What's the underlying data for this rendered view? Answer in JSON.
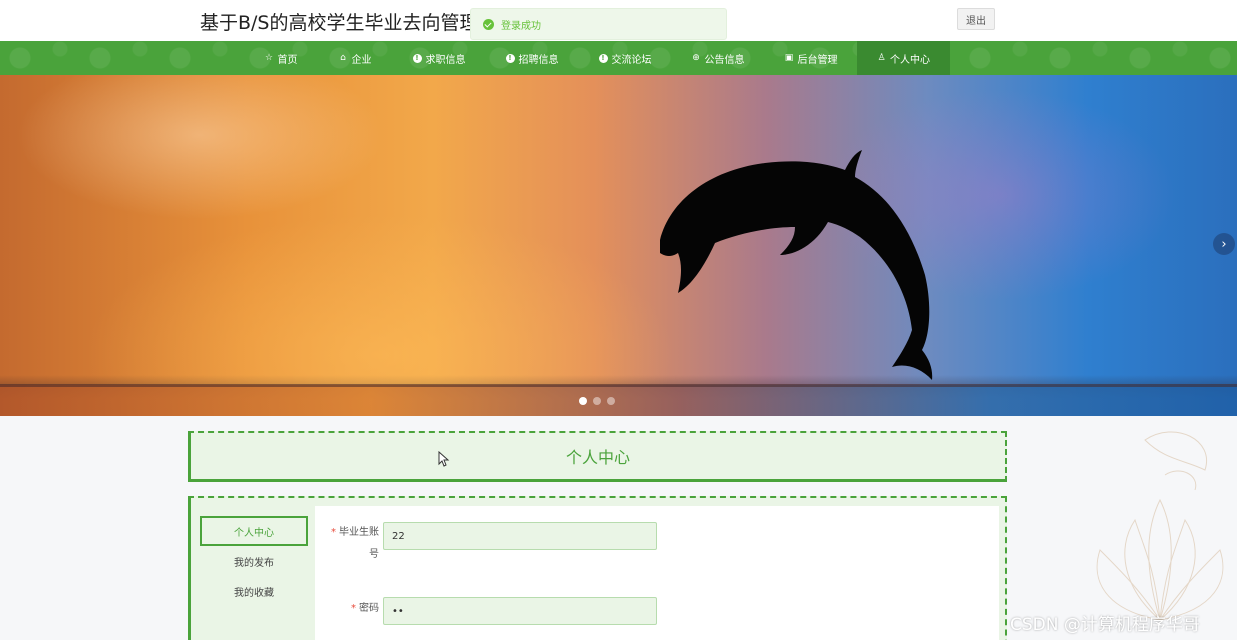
{
  "header": {
    "site_title": "基于B/S的高校学生毕业去向管理系统",
    "toast_message": "登录成功",
    "logout_label": "退出"
  },
  "nav": {
    "items": [
      {
        "label": "首页",
        "icon": "star-icon"
      },
      {
        "label": "企业",
        "icon": "home-icon"
      },
      {
        "label": "求职信息",
        "icon": "info-icon"
      },
      {
        "label": "招聘信息",
        "icon": "info-icon"
      },
      {
        "label": "交流论坛",
        "icon": "info-icon"
      },
      {
        "label": "公告信息",
        "icon": "globe-icon"
      },
      {
        "label": "后台管理",
        "icon": "briefcase-icon"
      },
      {
        "label": "个人中心",
        "icon": "user-icon"
      }
    ],
    "active": "个人中心",
    "color": "#4aa33b"
  },
  "banner": {
    "slide_count": 3,
    "active_slide": 1,
    "next_icon": "›"
  },
  "page": {
    "title": "个人中心"
  },
  "side_menu": {
    "items": [
      "个人中心",
      "我的发布",
      "我的收藏"
    ],
    "active": "个人中心"
  },
  "form": {
    "fields": [
      {
        "label": "毕业生账号",
        "value": "22",
        "required": true
      },
      {
        "label": "密码",
        "value": "••",
        "required": true
      }
    ]
  },
  "watermark": "CSDN @计算机程序华哥"
}
